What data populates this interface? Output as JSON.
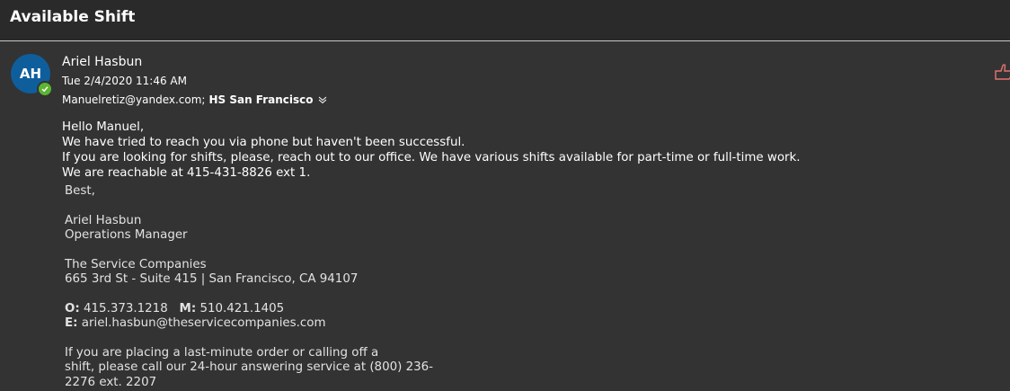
{
  "email": {
    "subject": "Available Shift",
    "sender": {
      "name": "Ariel Hasbun",
      "initials": "AH",
      "avatar_color": "#0f5e9c",
      "presence": "available",
      "presence_color": "#5cb531"
    },
    "date": "Tue 2/4/2020 11:46 AM",
    "recipients": {
      "email": "Manuelretiz@yandex.com;",
      "group": "HS San Francisco"
    },
    "body": [
      "Hello Manuel,",
      "We have tried to reach you via phone but haven't been successful.",
      "If you are looking for shifts, please, reach out to our office. We have various shifts available for part-time or full-time work.",
      "We are reachable at 415-431-8826 ext 1."
    ],
    "signature": {
      "closing": "Best,",
      "name": "Ariel Hasbun",
      "title": "Operations Manager",
      "company": "The Service Companies",
      "address": "665 3rd St - Suite 415 | San Francisco, CA 94107",
      "office_label": "O:",
      "office_phone": "415.373.1218",
      "mobile_label": "M:",
      "mobile_phone": "510.421.1405",
      "email_label": "E:",
      "email": "ariel.hasbun@theservicecompanies.com",
      "note": [
        "If you are placing a last-minute order or calling off a",
        "shift, please call our 24-hour answering service at (800) 236-",
        "2276 ext. 2207"
      ]
    },
    "icons": {
      "presence": "checkmark-icon",
      "expand": "chevron-down-icon",
      "like": "thumbs-up-icon"
    }
  }
}
